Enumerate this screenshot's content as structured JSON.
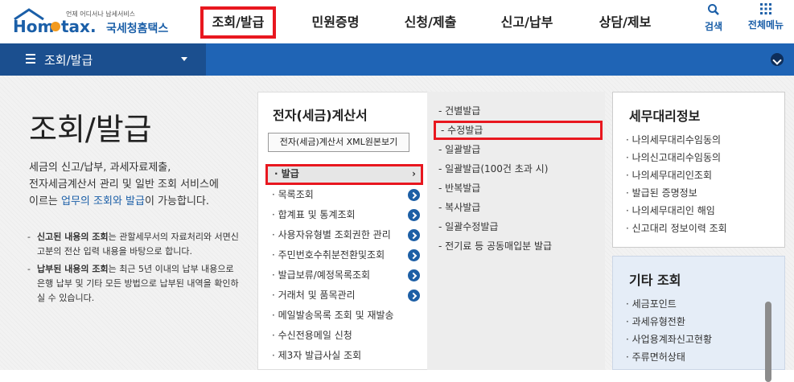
{
  "logo": {
    "brand": "Hometax",
    "tagline": "언제 어디서나 납세서비스",
    "name_ko": "국세청홈택스"
  },
  "nav": [
    {
      "label": "조회/발급",
      "active": true
    },
    {
      "label": "민원증명",
      "active": false
    },
    {
      "label": "신청/제출",
      "active": false
    },
    {
      "label": "신고/납부",
      "active": false
    },
    {
      "label": "상담/제보",
      "active": false
    }
  ],
  "tools": {
    "search_label": "검색",
    "allmenu_label": "전체메뉴"
  },
  "breadcrumb": {
    "label": "조회/발급"
  },
  "intro": {
    "title": "조회/발급",
    "desc_1": "세금의 신고/납부, 과세자료제출,",
    "desc_2": "전자세금계산서 관리 및 일반 조회 서비스에",
    "desc_3_pre": "이르는 ",
    "desc_3_hl": "업무의 조회와 발급",
    "desc_3_post": "이 가능합니다.",
    "note1_bold": "신고된 내용의 조회",
    "note1_rest": "는 관할세무서의 자료처리와 서면신고분의 전산 입력 내용을 바탕으로 합니다.",
    "note2_bold": "납부된 내용의 조회",
    "note2_rest": "는 최근 5년 이내의 납부 내용으로 은행 납부 및 기타 모든 방법으로 납부된 내역을 확인하실 수 있습니다."
  },
  "main_panel": {
    "title": "전자(세금)계산서",
    "xml_button": "전자(세금)계산서 XML원본보기",
    "items": [
      {
        "label": "발급",
        "selected": true
      },
      {
        "label": "목록조회"
      },
      {
        "label": "합계표 및 통계조회"
      },
      {
        "label": "사용자유형별 조회권한 관리"
      },
      {
        "label": "주민번호수취분전환및조회"
      },
      {
        "label": "발급보류/예정목록조회"
      },
      {
        "label": "거래처 및 품목관리"
      },
      {
        "label": "메일발송목록 조회 및 재발송"
      },
      {
        "label": "수신전용메일 신청"
      },
      {
        "label": "제3자 발급사실 조회"
      }
    ],
    "sub_items": [
      {
        "label": "건별발급"
      },
      {
        "label": "수정발급",
        "selected": true
      },
      {
        "label": "일괄발급"
      },
      {
        "label": "일괄발급(100건 초과 시)"
      },
      {
        "label": "반복발급"
      },
      {
        "label": "복사발급"
      },
      {
        "label": "일괄수정발급"
      },
      {
        "label": "전기료 등 공동매입분 발급"
      }
    ]
  },
  "tax_agent": {
    "title": "세무대리정보",
    "items": [
      "나의세무대리수임동의",
      "나의신고대리수임동의",
      "나의세무대리인조회",
      "발급된 증명정보",
      "나의세무대리인 해임",
      "신고대리 정보이력 조회"
    ]
  },
  "other": {
    "title": "기타 조회",
    "items": [
      "세금포인트",
      "과세유형전환",
      "사업용계좌신고현황",
      "주류면허상태"
    ]
  },
  "colors": {
    "accent_blue": "#1f64b5",
    "dark_blue": "#1b4f8f",
    "highlight_red": "#e8171f"
  }
}
